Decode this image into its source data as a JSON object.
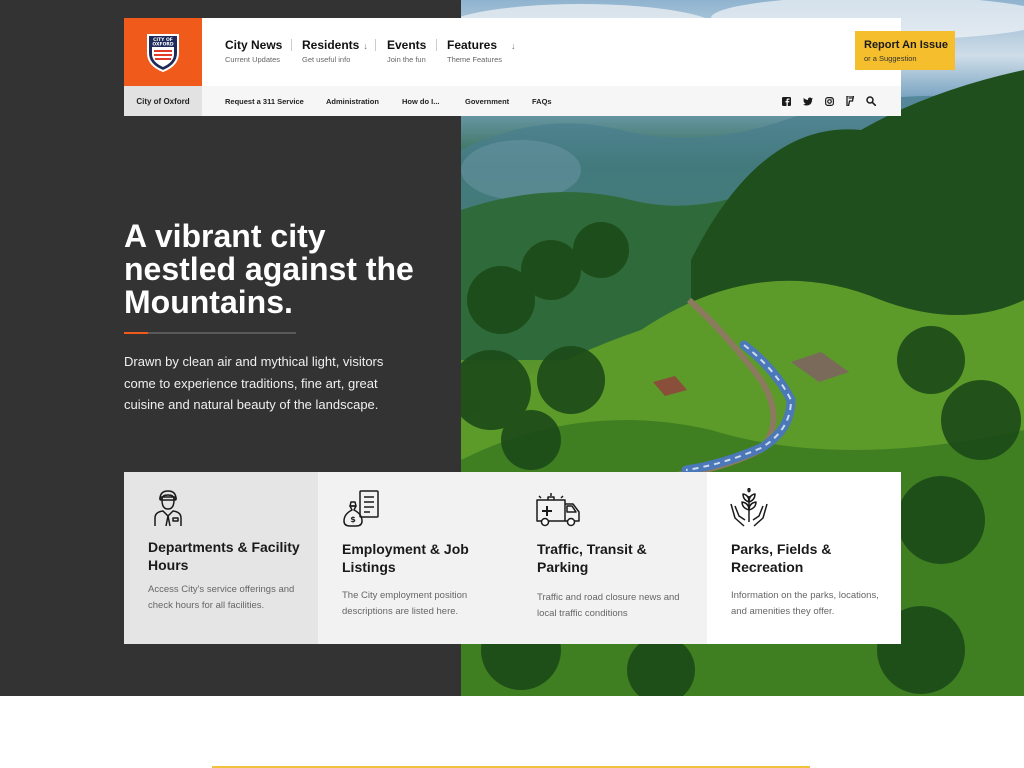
{
  "header": {
    "logo": {
      "text_top": "CITY OF",
      "text_bottom": "OXFORD"
    },
    "city_tab": "City of Oxford",
    "nav": [
      {
        "title": "City News",
        "subtitle": "Current Updates"
      },
      {
        "title": "Residents",
        "subtitle": "Get useful info"
      },
      {
        "title": "Events",
        "subtitle": "Join the fun"
      },
      {
        "title": "Features",
        "subtitle": "Theme Features"
      }
    ],
    "report": {
      "title": "Report An Issue",
      "subtitle": "or a Suggestion"
    },
    "sub_nav": [
      "Request a 311 Service",
      "Administration",
      "How do I...",
      "Government",
      "FAQs"
    ],
    "social_icons": [
      "facebook-icon",
      "twitter-icon",
      "instagram-icon",
      "foursquare-icon",
      "search-icon"
    ]
  },
  "hero": {
    "title": "A vibrant city nestled against the Mountains.",
    "text": "Drawn by clean air and mythical light, visitors come to experience traditions, fine art, great cuisine and natural beauty of the landscape."
  },
  "cards": [
    {
      "icon": "official-person-icon",
      "title": "Departments & Facility Hours",
      "text": "Access City's service offerings and check hours for all facilities."
    },
    {
      "icon": "job-listing-money-icon",
      "title": "Employment & Job Listings",
      "text": "The City employment position descriptions are listed here."
    },
    {
      "icon": "ambulance-icon",
      "title": "Traffic, Transit & Parking",
      "text": "Traffic and road closure news and local traffic conditions"
    },
    {
      "icon": "plant-hands-icon",
      "title": "Parks, Fields & Recreation",
      "text": "Information on the parks, locations, and amenities they offer."
    }
  ],
  "colors": {
    "accent_orange": "#f05a1a",
    "accent_yellow": "#f4be2c",
    "dark_panel": "#333333"
  }
}
